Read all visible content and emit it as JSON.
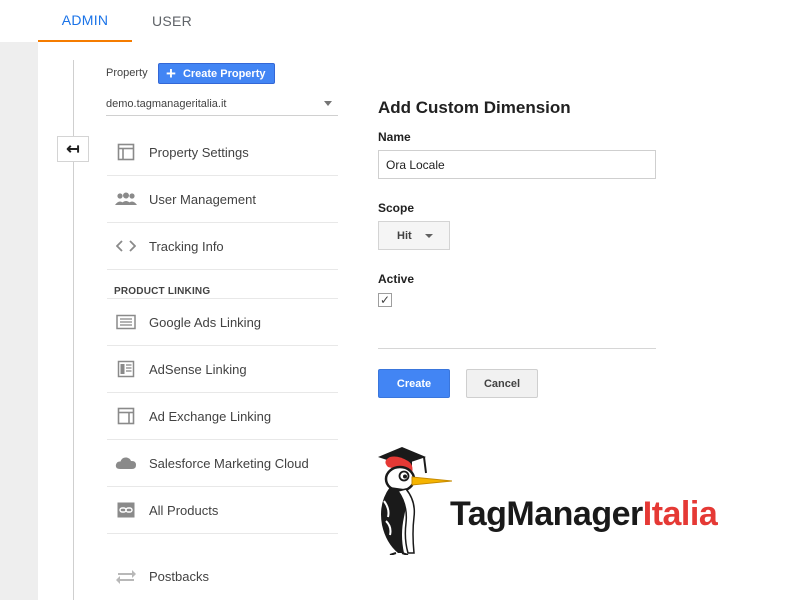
{
  "tabs": [
    {
      "label": "ADMIN",
      "active": true
    },
    {
      "label": "USER",
      "active": false
    }
  ],
  "property": {
    "label": "Property",
    "create_button": "Create Property",
    "selected": "demo.tagmanageritalia.it"
  },
  "nav": {
    "back_icon": "arrow-back-icon",
    "items": [
      {
        "label": "Property Settings",
        "icon": "property-settings-icon"
      },
      {
        "label": "User Management",
        "icon": "users-icon"
      },
      {
        "label": "Tracking Info",
        "icon": "code-icon"
      }
    ],
    "section_title": "PRODUCT LINKING",
    "linking_items": [
      {
        "label": "Google Ads Linking",
        "icon": "google-ads-icon"
      },
      {
        "label": "AdSense Linking",
        "icon": "adsense-icon"
      },
      {
        "label": "Ad Exchange Linking",
        "icon": "ad-exchange-icon"
      },
      {
        "label": "Salesforce Marketing Cloud",
        "icon": "cloud-icon"
      },
      {
        "label": "All Products",
        "icon": "link-icon"
      }
    ],
    "postbacks": {
      "label": "Postbacks",
      "icon": "postbacks-icon"
    }
  },
  "form": {
    "title": "Add Custom Dimension",
    "name_label": "Name",
    "name_value": "Ora Locale",
    "scope_label": "Scope",
    "scope_value": "Hit",
    "active_label": "Active",
    "active_checked": true,
    "checkmark": "✓",
    "create_label": "Create",
    "cancel_label": "Cancel"
  },
  "logo": {
    "text_part1": "TagManager",
    "text_part2": "Italia",
    "mascot_icon": "woodpecker-mascot-icon"
  },
  "colors": {
    "accent_blue": "#4285f4",
    "tab_underline": "#f57c00",
    "brand_red": "#e53935"
  }
}
